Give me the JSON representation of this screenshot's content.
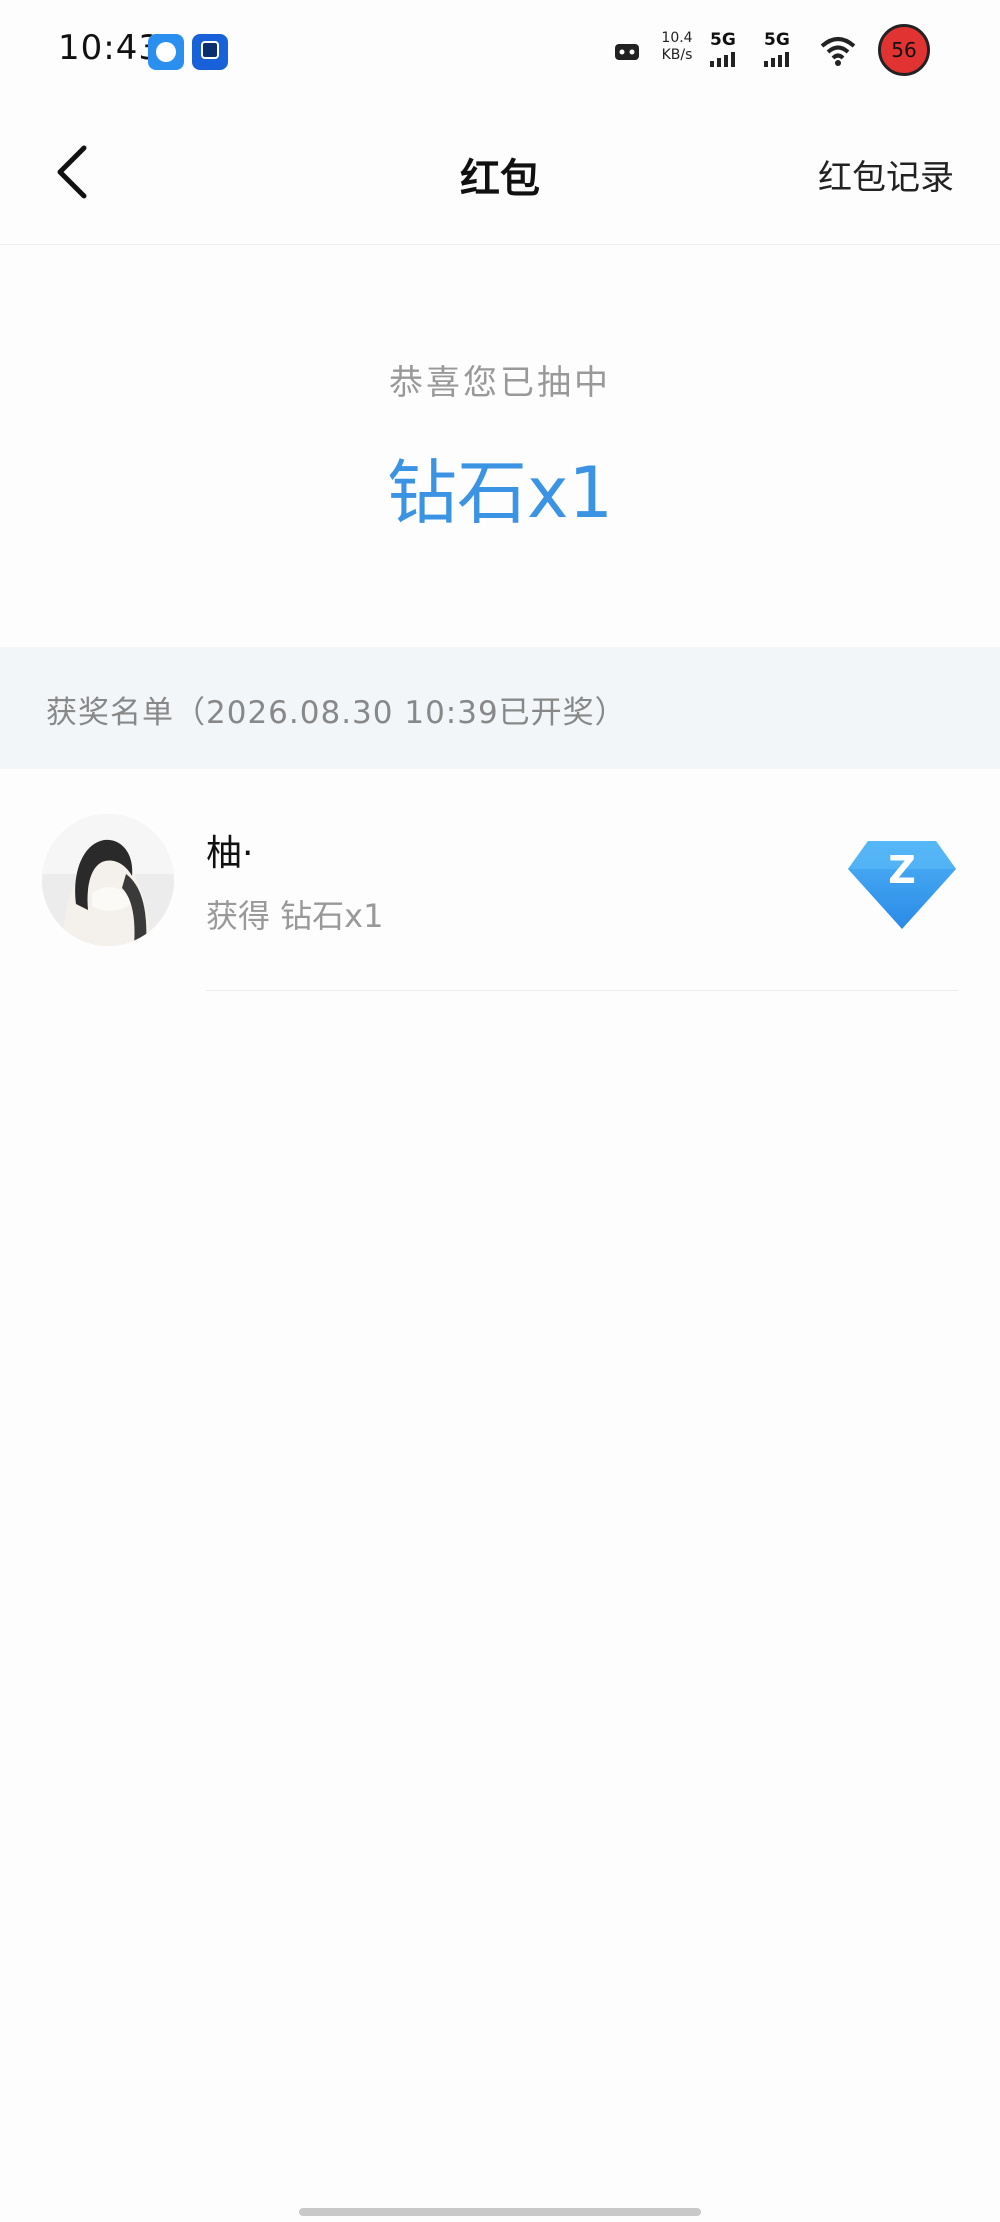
{
  "status_bar": {
    "time": "10:43",
    "net_speed_value": "10.4",
    "net_speed_unit": "KB/s",
    "signal_1": "5G",
    "signal_2": "5G",
    "battery": "56",
    "icons": [
      "app-icon-blue",
      "app-icon-browser",
      "game-controller-icon",
      "signal-icon",
      "signal-icon",
      "wifi-icon",
      "battery-icon"
    ]
  },
  "header": {
    "title": "红包",
    "right_link": "红包记录",
    "back_icon": "chevron-left-icon"
  },
  "result": {
    "subtitle": "恭喜您已抽中",
    "prize": "钻石x1",
    "accent_color": "#3b93e4"
  },
  "winners": {
    "header": "获奖名单（2026.08.30 10:39已开奖）",
    "items": [
      {
        "name": "柚·",
        "prize": "获得 钻石x1",
        "badge_icon": "diamond-icon",
        "badge_letter": "Z"
      }
    ]
  }
}
